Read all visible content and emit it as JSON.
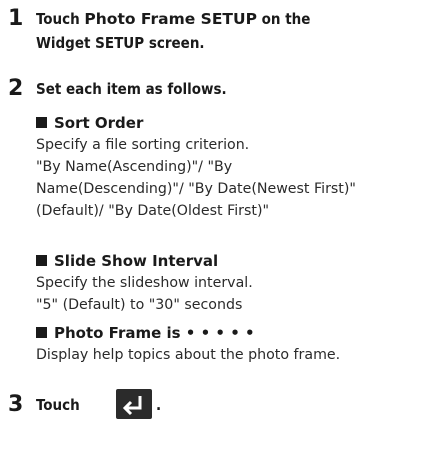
{
  "steps": [
    {
      "number": "1",
      "line1_prefix": "Touch ",
      "line1_keyword": "Photo Frame SETUP",
      "line1_suffix": " on the",
      "line2": "Widget SETUP screen."
    },
    {
      "number": "2",
      "text": "Set each item as follows."
    },
    {
      "number": "3",
      "text_before": "Touch",
      "text_after": ".",
      "icon": "back-arrow-icon"
    }
  ],
  "items": [
    {
      "heading": "Sort Order",
      "lines": [
        "Specify a file sorting criterion.",
        "\"By Name(Ascending)\"/ \"By",
        "Name(Descending)\"/ \"By Date(Newest First)\"",
        "(Default)/ \"By Date(Oldest First)\""
      ]
    },
    {
      "heading": "Slide Show Interval",
      "lines": [
        "Specify the slideshow interval.",
        "\"5\" (Default) to \"30\" seconds"
      ]
    },
    {
      "heading": "Photo Frame is • • • • •",
      "lines": [
        "Display help topics about the photo frame."
      ]
    }
  ],
  "colors": {
    "text": "#1a1a1a",
    "button_bg": "#2b2b2b",
    "button_icon": "#ffffff"
  }
}
